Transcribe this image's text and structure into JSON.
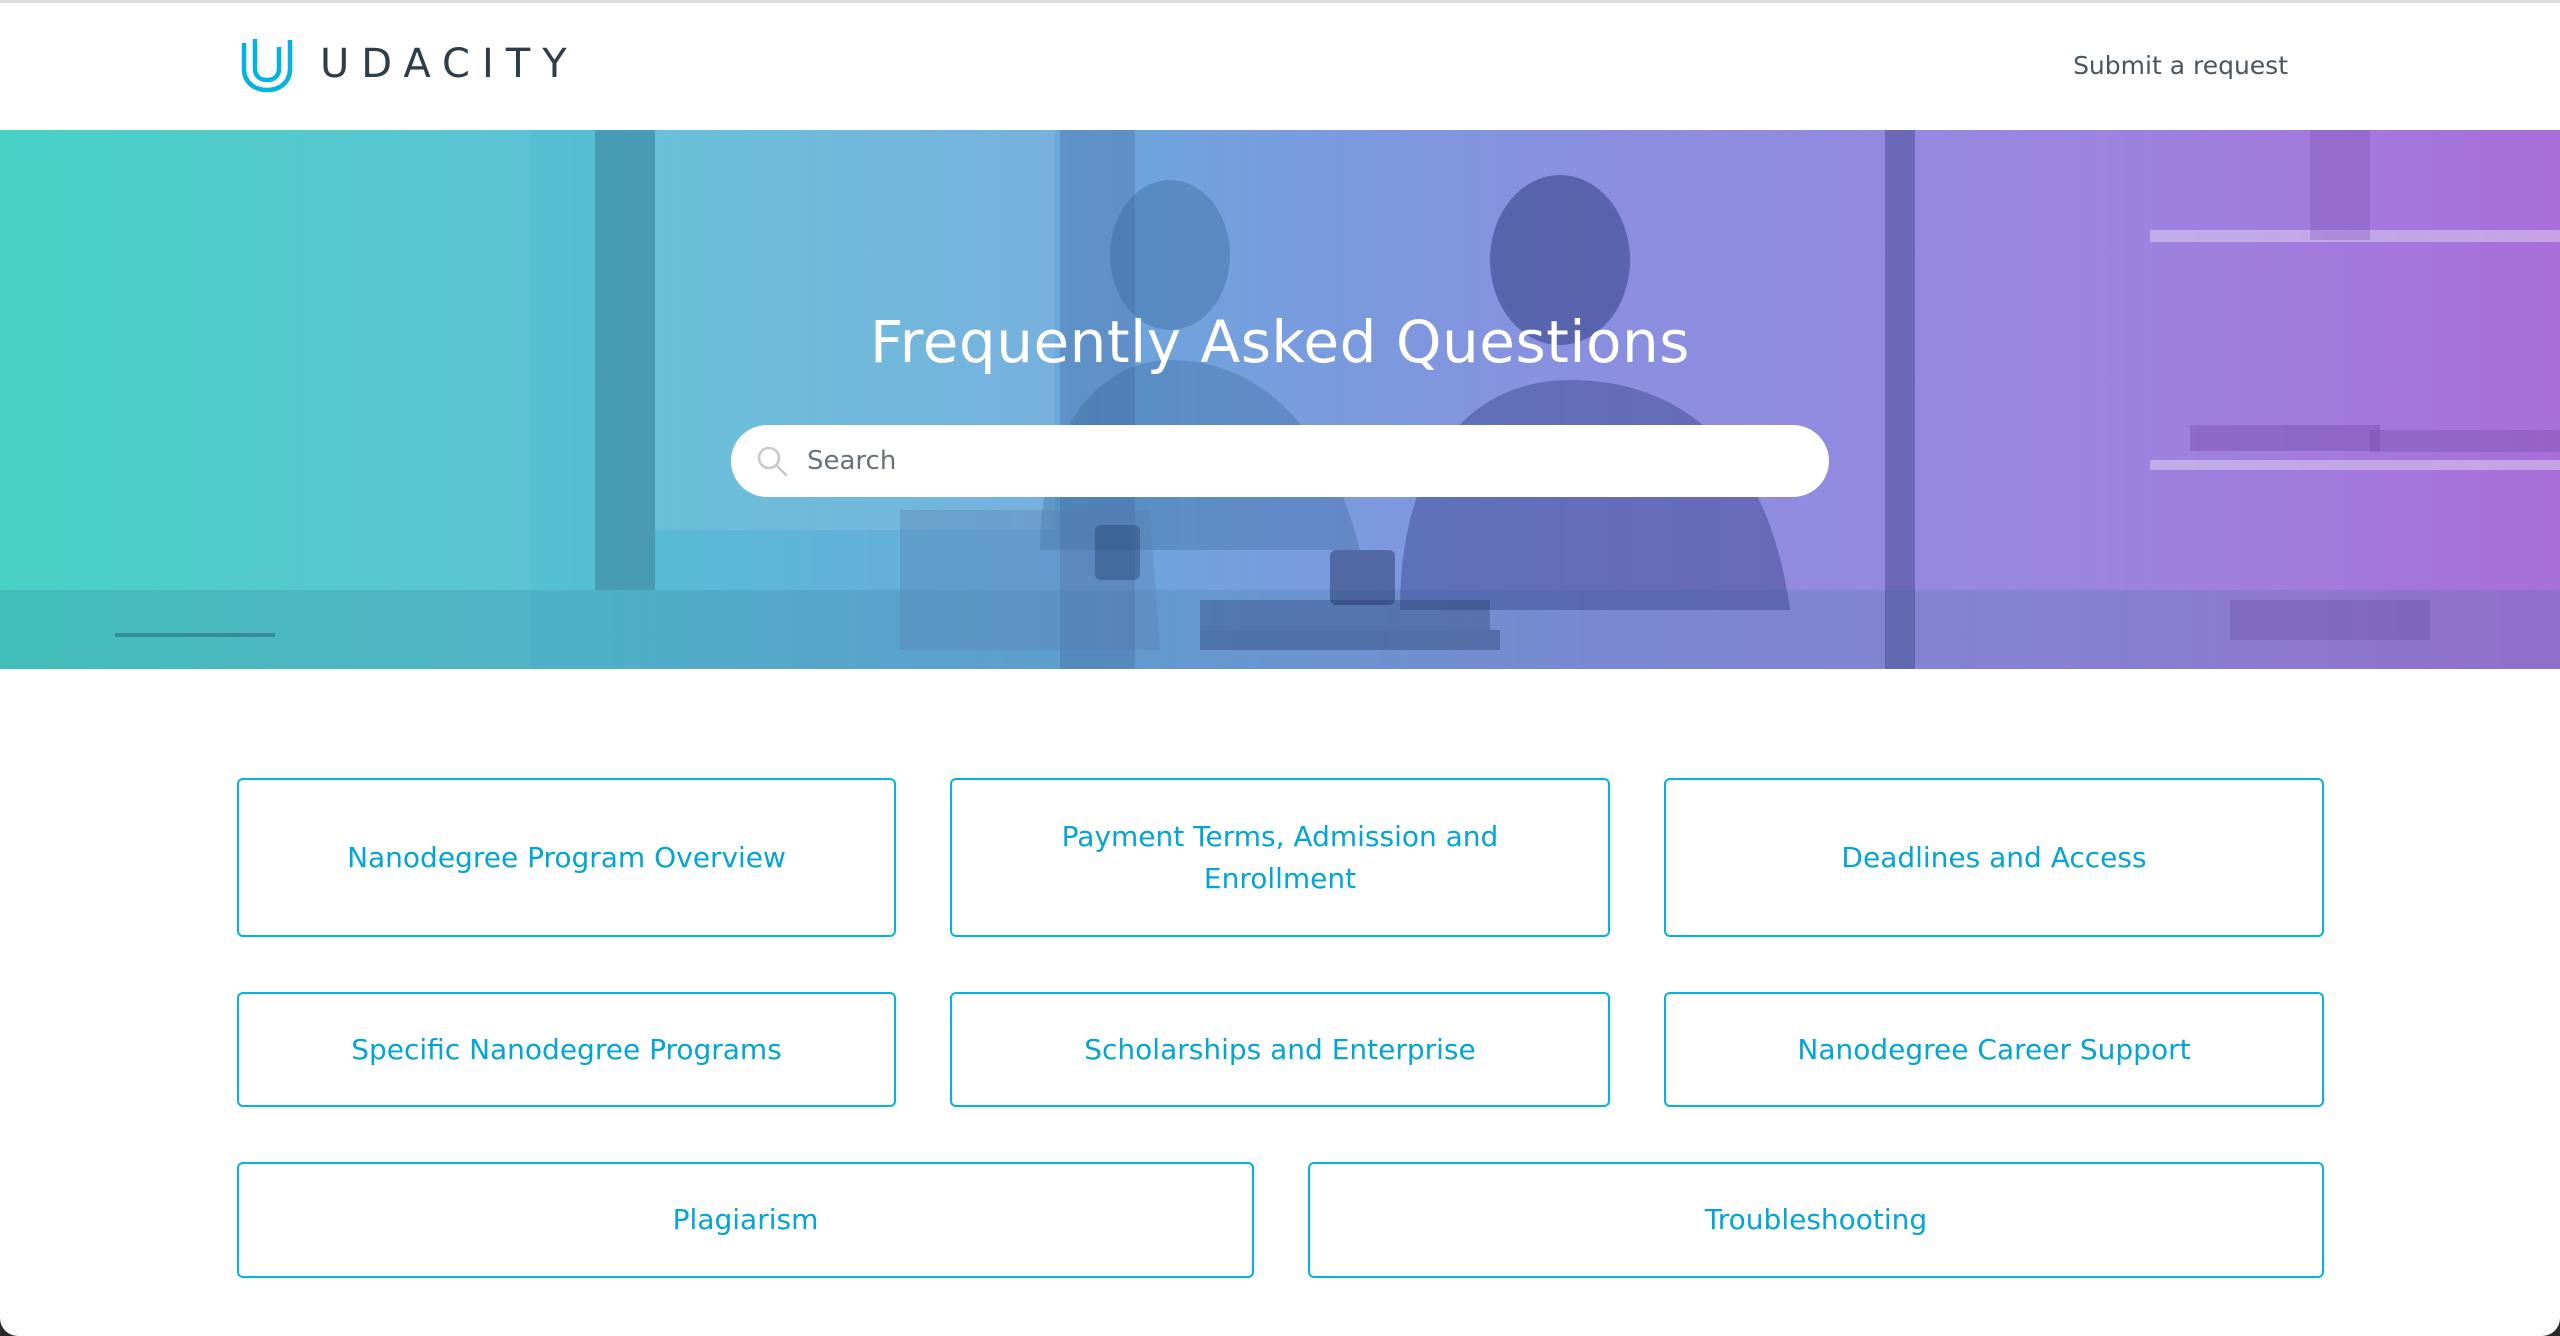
{
  "header": {
    "logo_text": "UDACITY",
    "submit_request": "Submit a request"
  },
  "hero": {
    "title": "Frequently Asked Questions",
    "search_placeholder": "Search"
  },
  "categories": [
    "Nanodegree Program Overview",
    "Payment Terms, Admission and Enrollment",
    "Deadlines and Access",
    "Specific Nanodegree Programs",
    "Scholarships and Enterprise",
    "Nanodegree Career Support",
    "Plagiarism",
    "Troubleshooting"
  ],
  "colors": {
    "accent": "#02b3e4",
    "hero_start": "#3ecfc0",
    "hero_end": "#a86fd9",
    "text_dark": "#2e3d49"
  },
  "icons": {
    "logo": "udacity-u-icon",
    "search": "search-icon"
  }
}
